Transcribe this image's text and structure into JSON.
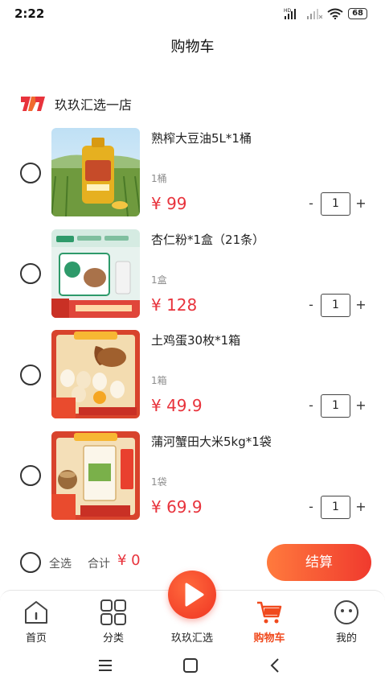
{
  "status_bar": {
    "time": "2:22",
    "network": "HD",
    "battery": "68"
  },
  "page": {
    "title": "购物车"
  },
  "store": {
    "name": "玖玖汇选一店",
    "logo_icon": "store-logo-icon"
  },
  "cart_items": [
    {
      "title": "熟榨大豆油5L*1桶",
      "unit": "1桶",
      "price": "¥ 99",
      "quantity": "1",
      "image_icon": "soybean-oil-image"
    },
    {
      "title": "杏仁粉*1盒（21条）",
      "unit": "1盒",
      "price": "¥ 128",
      "quantity": "1",
      "image_icon": "almond-powder-image"
    },
    {
      "title": "土鸡蛋30枚*1箱",
      "unit": "1箱",
      "price": "¥ 49.9",
      "quantity": "1",
      "image_icon": "eggs-image"
    },
    {
      "title": "蒲河蟹田大米5kg*1袋",
      "unit": "1袋",
      "price": "¥ 69.9",
      "quantity": "1",
      "image_icon": "rice-image"
    }
  ],
  "stepper": {
    "minus": "-",
    "plus": "+"
  },
  "footer": {
    "select_all": "全选",
    "total_label": "合计",
    "total_value": "¥ 0",
    "checkout": "结算"
  },
  "tabbar": [
    {
      "label": "首页",
      "icon": "home-icon"
    },
    {
      "label": "分类",
      "icon": "grid-icon"
    },
    {
      "label": "玖玖汇选",
      "icon": "play-icon"
    },
    {
      "label": "购物车",
      "icon": "cart-icon",
      "active": true
    },
    {
      "label": "我的",
      "icon": "smiley-icon"
    }
  ],
  "colors": {
    "accent": "#e8333c",
    "tab_active": "#f04a1e",
    "checkout_start": "#ff7a3d",
    "checkout_end": "#f03a2e"
  }
}
